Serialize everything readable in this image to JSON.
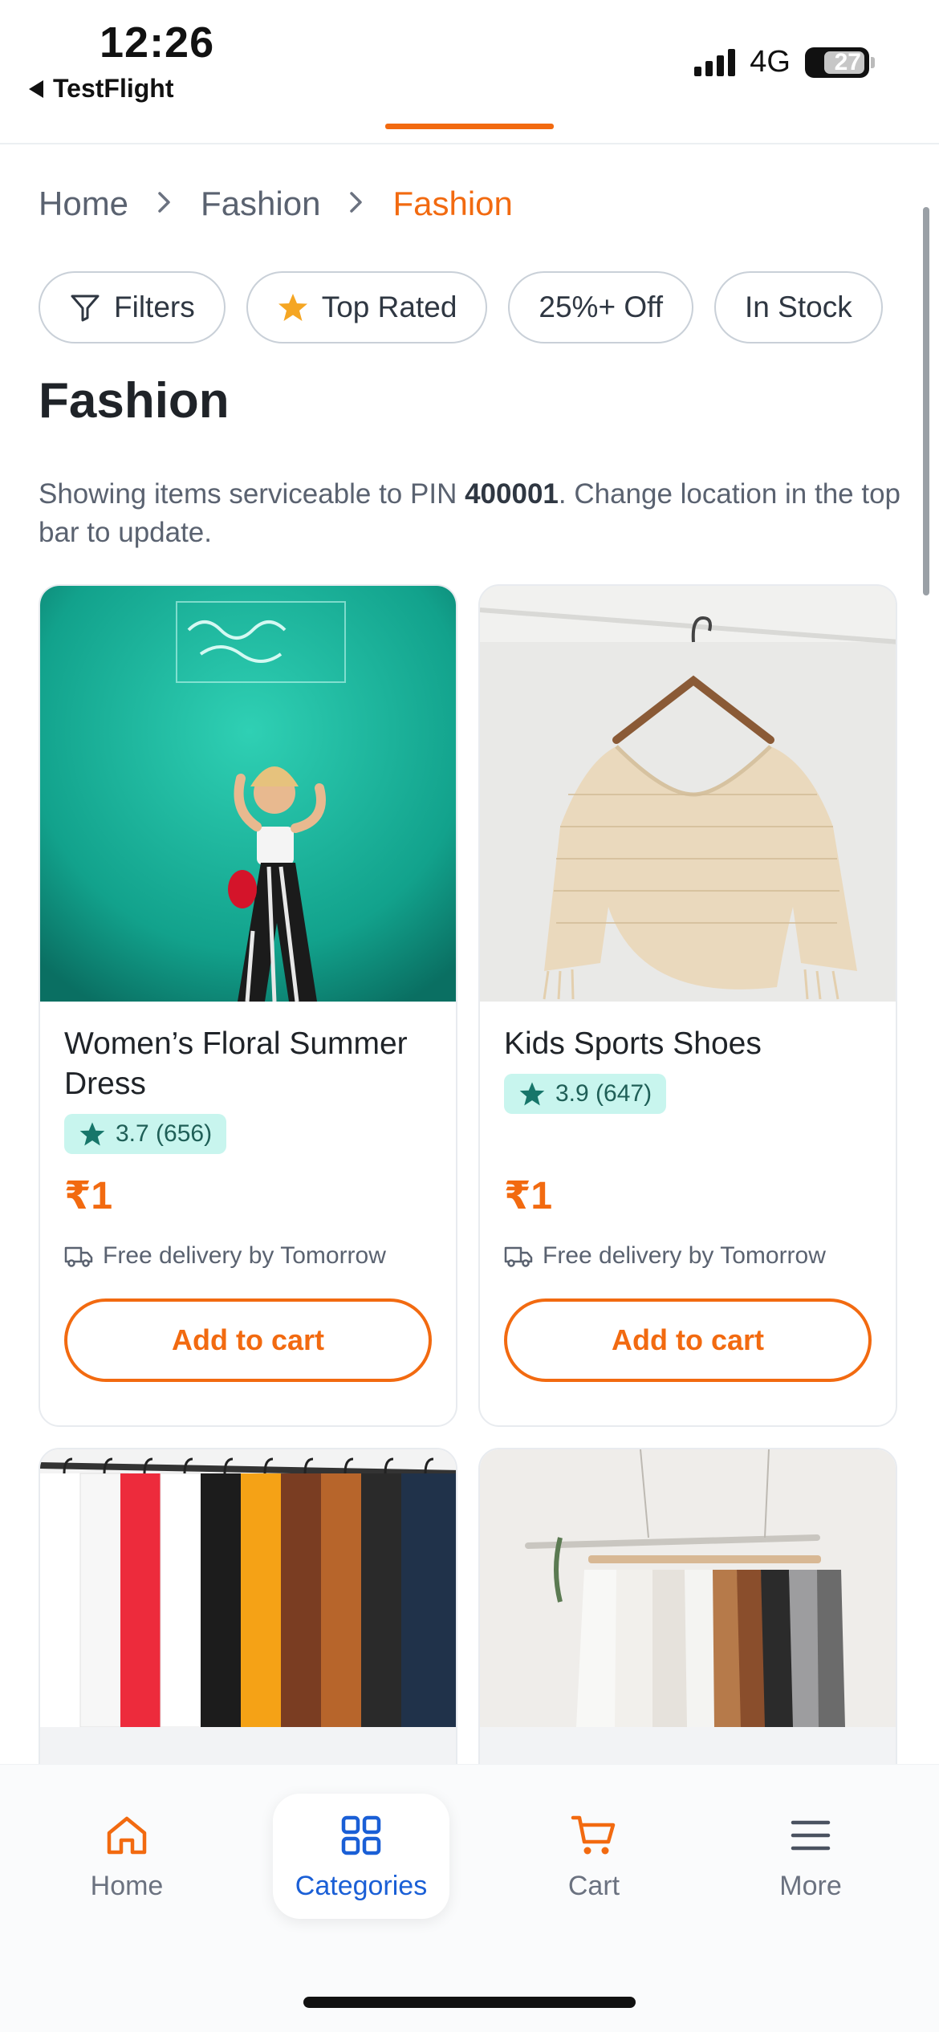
{
  "status_bar": {
    "time": "12:26",
    "back_app": "TestFlight",
    "network": "4G",
    "battery": "27"
  },
  "breadcrumb": {
    "items": [
      "Home",
      "Fashion",
      "Fashion"
    ],
    "separator": ">"
  },
  "chips": [
    {
      "label": "Filters",
      "icon": "filter-icon"
    },
    {
      "label": "Top Rated",
      "icon": "star-icon"
    },
    {
      "label": "25%+ Off"
    },
    {
      "label": "In Stock"
    }
  ],
  "page": {
    "title": "Fashion",
    "notice_prefix": "Showing items serviceable to PIN ",
    "pin": "400001",
    "notice_suffix": ". Change location in the top bar to update."
  },
  "products": [
    {
      "title": "Women’s Floral Summer Dress",
      "rating": "3.7 (656)",
      "price": "₹1",
      "delivery": "Free delivery by Tomorrow",
      "button": "Add to cart"
    },
    {
      "title": "Kids Sports Shoes",
      "rating": "3.9 (647)",
      "price": "₹1",
      "delivery": "Free delivery by Tomorrow",
      "button": "Add to cart"
    }
  ],
  "bottom_nav": [
    {
      "label": "Home",
      "icon": "home-icon"
    },
    {
      "label": "Categories",
      "icon": "grid-icon",
      "active": true
    },
    {
      "label": "Cart",
      "icon": "cart-icon"
    },
    {
      "label": "More",
      "icon": "menu-icon"
    }
  ],
  "colors": {
    "accent": "#f26a10",
    "active_nav": "#1a5fd6",
    "rating_bg": "#c8f5ee"
  }
}
